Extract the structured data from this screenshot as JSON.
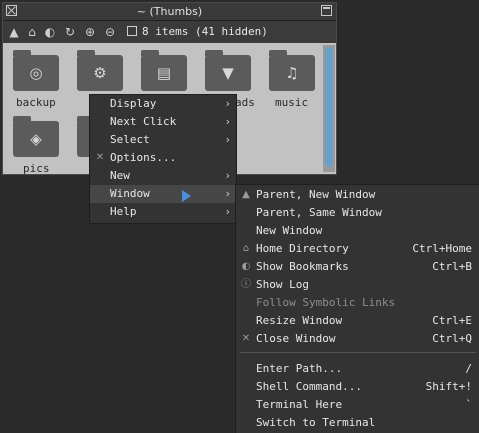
{
  "window": {
    "title": "~ (Thumbs)",
    "item_count": "8 items (41 hidden)"
  },
  "toolbar": {
    "icons": [
      "up-icon",
      "home-icon",
      "bookmarks-icon",
      "refresh-icon",
      "zoom-in-icon",
      "zoom-out-icon",
      "show-hidden-checkbox"
    ]
  },
  "folders": [
    {
      "label": "backup",
      "icon": "record-icon"
    },
    {
      "label": "",
      "icon": "gear-icon"
    },
    {
      "label": "",
      "icon": "document-icon"
    },
    {
      "label": "ads",
      "icon": "download-icon"
    },
    {
      "label": "music",
      "icon": "headphones-icon"
    },
    {
      "label": "pics",
      "icon": "pictures-icon"
    },
    {
      "label": "",
      "icon": "folder-icon"
    }
  ],
  "main_menu": {
    "items": [
      {
        "label": "Display",
        "submenu": true
      },
      {
        "label": "Next Click",
        "submenu": true
      },
      {
        "label": "Select",
        "submenu": true
      },
      {
        "label": "Options...",
        "submenu": false,
        "icon": "options-icon"
      },
      {
        "label": "New",
        "submenu": true
      },
      {
        "label": "Window",
        "submenu": true,
        "active": true
      },
      {
        "label": "Help",
        "submenu": true
      }
    ]
  },
  "window_menu": {
    "items": [
      {
        "label": "Parent, New Window",
        "shortcut": "",
        "icon": "up-icon"
      },
      {
        "label": "Parent, Same Window",
        "shortcut": ""
      },
      {
        "label": "New Window",
        "shortcut": ""
      },
      {
        "label": "Home Directory",
        "shortcut": "Ctrl+Home",
        "icon": "home-icon"
      },
      {
        "label": "Show Bookmarks",
        "shortcut": "Ctrl+B",
        "icon": "bookmarks-icon"
      },
      {
        "label": "Show Log",
        "shortcut": "",
        "icon": "info-icon"
      },
      {
        "label": "Follow Symbolic Links",
        "shortcut": "",
        "disabled": true
      },
      {
        "label": "Resize Window",
        "shortcut": "Ctrl+E"
      },
      {
        "label": "Close Window",
        "shortcut": "Ctrl+Q",
        "icon": "close-icon"
      },
      {
        "label": "Enter Path...",
        "shortcut": "/"
      },
      {
        "label": "Shell Command...",
        "shortcut": "Shift+!"
      },
      {
        "label": "Terminal Here",
        "shortcut": "`"
      },
      {
        "label": "Switch to Terminal",
        "shortcut": ""
      }
    ]
  },
  "colors": {
    "desktop": "#2a2a2a",
    "menu_bg": "#333333",
    "highlight": "#474747",
    "scrollbar": "#6aa0c8",
    "cursor": "#4a90d9"
  }
}
